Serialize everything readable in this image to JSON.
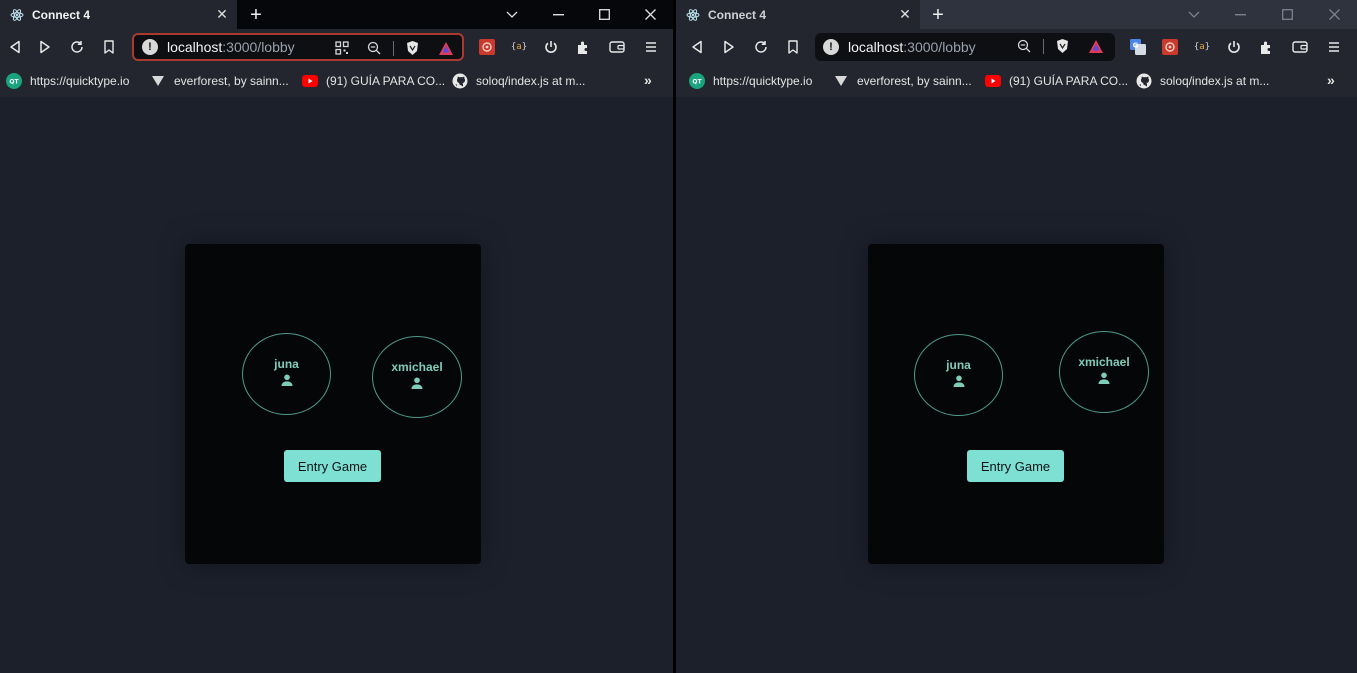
{
  "tab": {
    "title": "Connect 4"
  },
  "address": {
    "host": "localhost",
    "rest": ":3000/lobby"
  },
  "bookmarks": [
    {
      "label": "https://quicktype.io",
      "icon": "quicktype-icon"
    },
    {
      "label": "everforest, by sainn...",
      "icon": "everforest-icon"
    },
    {
      "label": "(91) GUÍA PARA CO...",
      "icon": "youtube-icon"
    },
    {
      "label": "soloq/index.js at m...",
      "icon": "github-icon"
    }
  ],
  "bookmarks_more": "»",
  "lobby": {
    "players": [
      {
        "name": "juna",
        "icon": "user-icon"
      },
      {
        "name": "xmichael",
        "icon": "user-icon"
      }
    ],
    "entry_button": "Entry Game"
  },
  "colors": {
    "accent": "#7ee0d3",
    "player_text": "#7fcdb8",
    "card": "#050608",
    "page_bg": "#1c202b",
    "toolbar": "#23262f"
  }
}
